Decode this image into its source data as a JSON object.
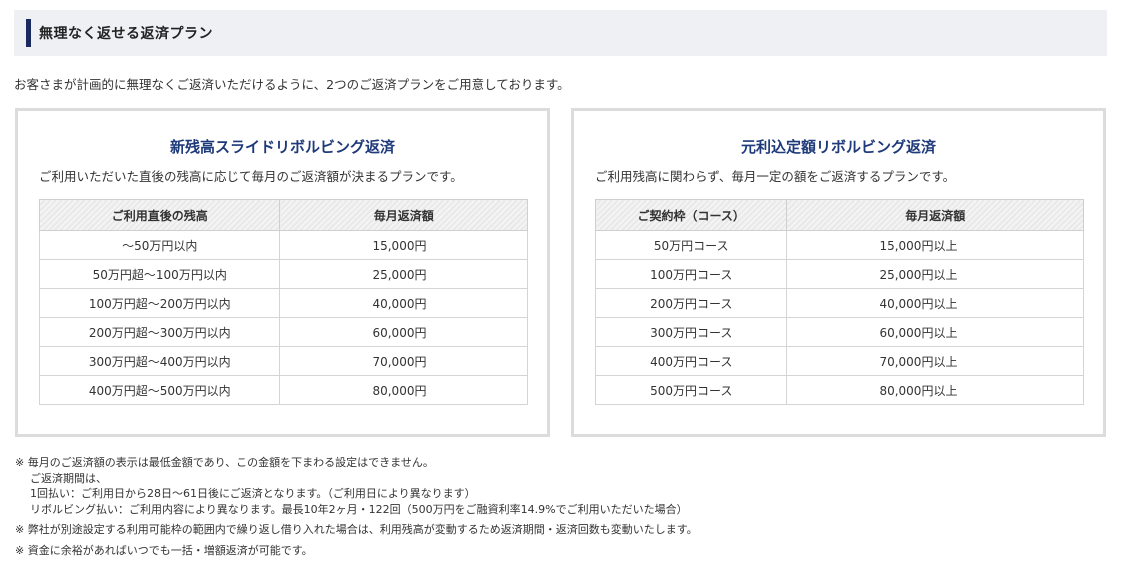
{
  "section": {
    "title": "無理なく返せる返済プラン"
  },
  "intro": "お客さまが計画的に無理なくご返済いただけるように、2つのご返済プランをご用意しております。",
  "plans": [
    {
      "title": "新残高スライドリボルビング返済",
      "description": "ご利用いただいた直後の残高に応じて毎月のご返済額が決まるプランです。",
      "headers": [
        "ご利用直後の残高",
        "毎月返済額"
      ],
      "rows": [
        [
          "～50万円以内",
          "15,000円"
        ],
        [
          "50万円超～100万円以内",
          "25,000円"
        ],
        [
          "100万円超～200万円以内",
          "40,000円"
        ],
        [
          "200万円超～300万円以内",
          "60,000円"
        ],
        [
          "300万円超～400万円以内",
          "70,000円"
        ],
        [
          "400万円超～500万円以内",
          "80,000円"
        ]
      ]
    },
    {
      "title": "元利込定額リボルビング返済",
      "description": "ご利用残高に関わらず、毎月一定の額をご返済するプランです。",
      "headers": [
        "ご契約枠（コース）",
        "毎月返済額"
      ],
      "rows": [
        [
          "50万円コース",
          "15,000円以上"
        ],
        [
          "100万円コース",
          "25,000円以上"
        ],
        [
          "200万円コース",
          "40,000円以上"
        ],
        [
          "300万円コース",
          "60,000円以上"
        ],
        [
          "400万円コース",
          "70,000円以上"
        ],
        [
          "500万円コース",
          "80,000円以上"
        ]
      ]
    }
  ],
  "notes": {
    "line1": "※ 毎月のご返済額の表示は最低金額であり、この金額を下まわる設定はできません。",
    "line2": "ご返済期間は、",
    "line3": "1回払い：ご利用日から28日～61日後にご返済となります。（ご利用日により異なります）",
    "line4": "リボルビング払い：ご利用内容により異なります。最長10年2ヶ月・122回（500万円をご融資利率14.9%でご利用いただいた場合）",
    "line5": "※ 弊社が別途設定する利用可能枠の範囲内で繰り返し借り入れた場合は、利用残高が変動するため返済期間・返済回数も変動いたします。",
    "line6": "※ 資金に余裕があればいつでも一括・増額返済が可能です。"
  }
}
